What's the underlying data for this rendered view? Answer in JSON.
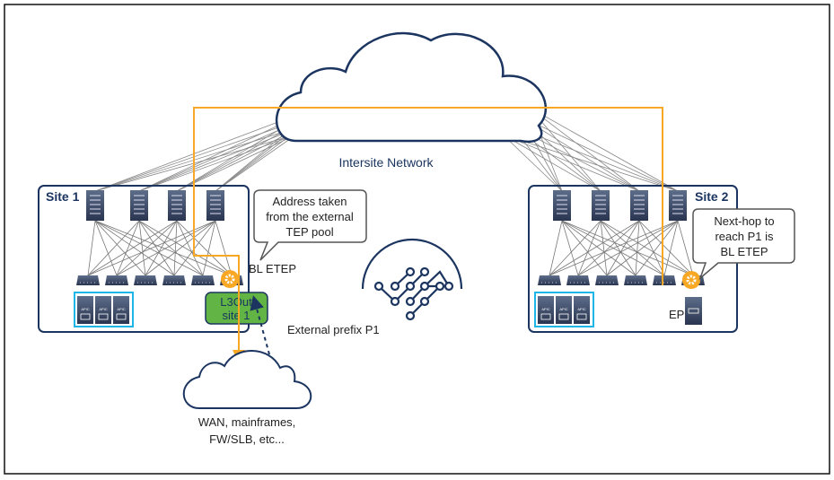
{
  "intersite": {
    "label": "Intersite Network"
  },
  "site1": {
    "label": "Site 1",
    "l3out_line1": "L3Out",
    "l3out_line2": "site 1",
    "bl_etep": "BL ETEP"
  },
  "site2": {
    "label": "Site 2",
    "ep": "EP"
  },
  "callout1": {
    "lines": [
      "Address taken",
      "from the external",
      "TEP pool"
    ]
  },
  "callout2": {
    "lines": [
      "Next-hop to",
      "reach P1 is",
      "BL ETEP"
    ]
  },
  "external_prefix": "External prefix P1",
  "external_cloud": {
    "lines": [
      "WAN, mainframes,",
      "FW/SLB, etc..."
    ]
  },
  "apic_label": "APIC",
  "colors": {
    "navy": "#1b3560",
    "orange": "#f8a825",
    "green": "#62b544",
    "cyan": "#1eb6e6",
    "mesh": "#707070"
  }
}
